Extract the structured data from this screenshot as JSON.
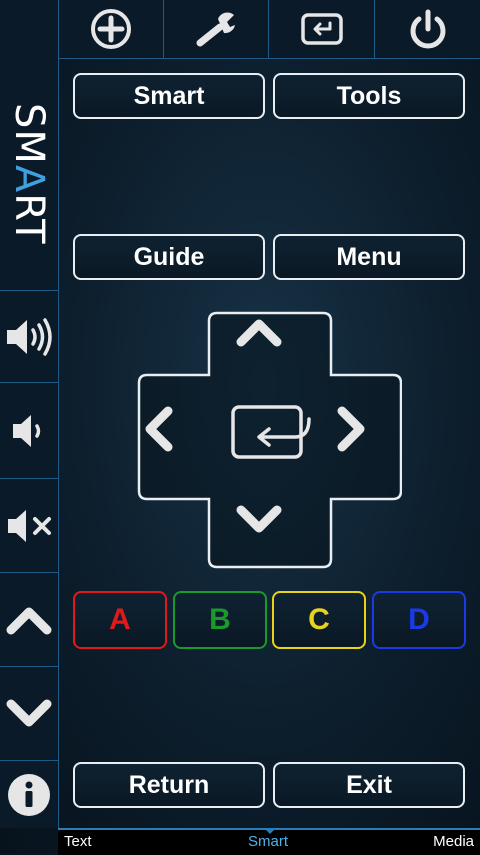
{
  "topbar": {
    "items": [
      {
        "icon": "add-circle-icon"
      },
      {
        "icon": "wrench-icon"
      },
      {
        "icon": "source-input-icon"
      },
      {
        "icon": "power-icon"
      }
    ]
  },
  "sidebar": {
    "logo": {
      "before": "SM",
      "accent": "A",
      "after": "RT"
    },
    "items": [
      {
        "icon": "volume-up-icon"
      },
      {
        "icon": "volume-down-icon"
      },
      {
        "icon": "mute-icon"
      },
      {
        "icon": "channel-up-icon"
      },
      {
        "icon": "channel-down-icon"
      },
      {
        "icon": "info-icon"
      }
    ]
  },
  "buttons": {
    "smart": "Smart",
    "tools": "Tools",
    "guide": "Guide",
    "menu": "Menu",
    "return": "Return",
    "exit": "Exit"
  },
  "color_buttons": [
    {
      "label": "A",
      "color": "#e01a1a"
    },
    {
      "label": "B",
      "color": "#1a9a2a"
    },
    {
      "label": "C",
      "color": "#e8d21a"
    },
    {
      "label": "D",
      "color": "#1a3ae8"
    }
  ],
  "tabs": {
    "text": "Text",
    "smart": "Smart",
    "media": "Media",
    "active_color": "#4fb0ea"
  }
}
